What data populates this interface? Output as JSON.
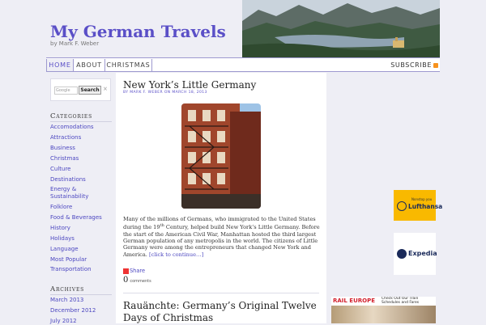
{
  "header": {
    "title": "My German Travels",
    "byline": "by Mark F. Weber"
  },
  "nav": {
    "tabs": [
      {
        "label": "HOME"
      },
      {
        "label": "ABOUT"
      },
      {
        "label": "CHRISTMAS"
      }
    ],
    "subscribe": "SUBSCRIBE"
  },
  "search": {
    "placeholder": "Google",
    "button": "Search",
    "clear": "×"
  },
  "categories": {
    "heading": "Categories",
    "items": [
      "Accomodations",
      "Attractions",
      "Business",
      "Christmas",
      "Culture",
      "Destinations",
      "Energy & Sustainability",
      "Folklore",
      "Food & Beverages",
      "History",
      "Holidays",
      "Language",
      "Most Popular",
      "Transportation"
    ]
  },
  "archives": {
    "heading": "Archives",
    "items": [
      "March 2013",
      "December 2012",
      "July 2012"
    ]
  },
  "post1": {
    "title": "New York’s Little Germany",
    "meta_by": "BY MARK F. WEBER",
    "meta_on": "ON MARCH 18, 2013",
    "text_a": "Many of the millions of Germans, who immigrated to the United States during the 19",
    "text_sup": "th",
    "text_b": " Century, helped build New York’s Little Germany.    Before the start of the American Civil War, Manhattan hosted the third largest German population of any metropolis in the world.  The citizens of Little Germany were among the entrepreneurs that changed New York and America. ",
    "read_more": "[click to continue…]",
    "share": "Share",
    "comments_count": "0",
    "comments_label": "comments"
  },
  "post2": {
    "title": "Rauänchte: Germany’s Original Twelve Days of Christmas"
  },
  "ads": {
    "lufthansa_small": "Nonstop you",
    "lufthansa": "Lufthansa",
    "expedia": "Expedia",
    "rail_brand": "RAIL EUROPE",
    "rail_text": "Check Out Our Train Schedules and Fares"
  }
}
